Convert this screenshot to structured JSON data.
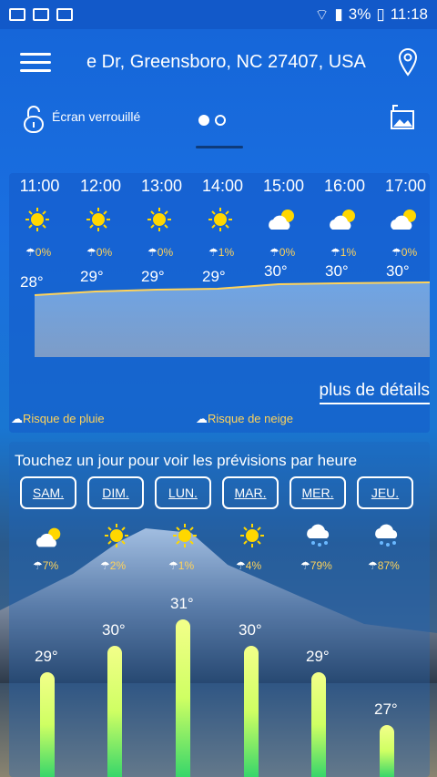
{
  "status_bar": {
    "battery": "3%",
    "time": "11:18"
  },
  "header": {
    "location": "e Dr, Greensboro, NC 27407, USA",
    "lock_label": "Écran verrouillé"
  },
  "hourly": {
    "hours": [
      "11:00",
      "12:00",
      "13:00",
      "14:00",
      "15:00",
      "16:00",
      "17:00"
    ],
    "icons": [
      "sun-icon",
      "sun-icon",
      "sun-icon",
      "sun-icon",
      "partly-cloudy-icon",
      "partly-cloudy-icon",
      "partly-cloudy-icon"
    ],
    "rain": [
      "0%",
      "0%",
      "0%",
      "1%",
      "0%",
      "1%",
      "0%"
    ],
    "temps": [
      "28°",
      "29°",
      "29°",
      "29°",
      "30°",
      "30°",
      "30°"
    ],
    "details_label": "plus de détails",
    "legend_rain": "Risque de pluie",
    "legend_snow": "Risque de neige"
  },
  "daily": {
    "prompt": "Touchez un jour pour voir les prévisions par heure",
    "days": [
      "SAM.",
      "DIM.",
      "LUN.",
      "MAR.",
      "MER.",
      "JEU."
    ],
    "icons": [
      "partly-cloudy-icon",
      "sun-icon",
      "sun-icon",
      "sun-icon",
      "rain-cloud-icon",
      "rain-cloud-icon"
    ],
    "rain": [
      "7%",
      "2%",
      "1%",
      "4%",
      "79%",
      "87%"
    ],
    "temps": [
      "29°",
      "30°",
      "31°",
      "30°",
      "29°",
      "27°"
    ],
    "temp_values": [
      29,
      30,
      31,
      30,
      29,
      27
    ]
  },
  "colors": {
    "accent_yellow": "#ffd35a",
    "sun": "#ffd700"
  }
}
